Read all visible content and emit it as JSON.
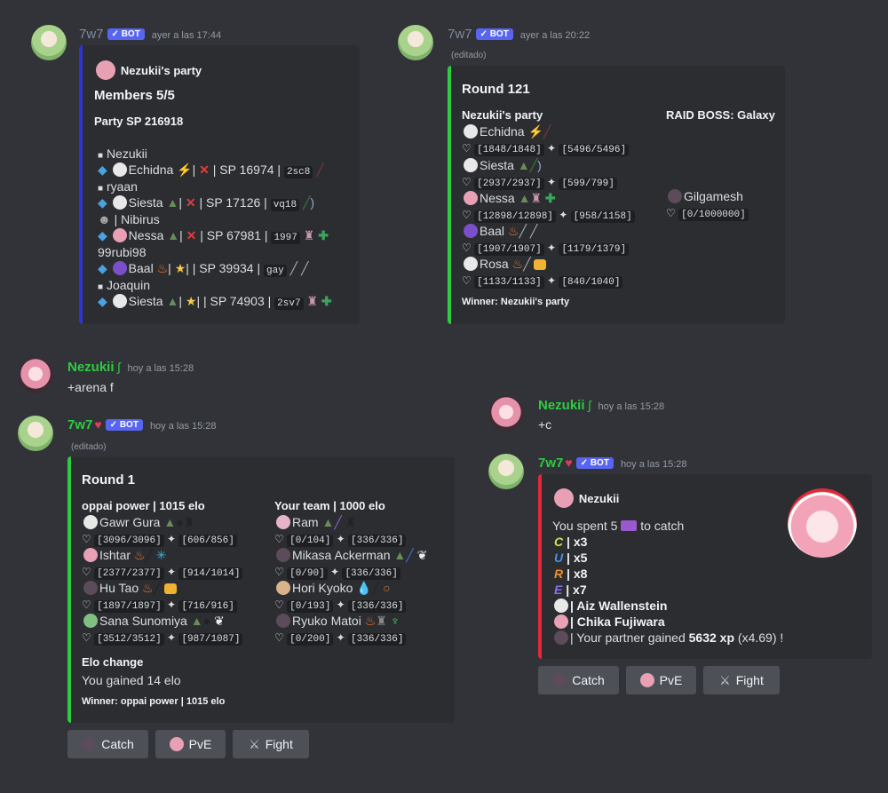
{
  "m1": {
    "user": "7w7",
    "bot": "✓ BOT",
    "time": "ayer a las 17:44",
    "author": "Nezukii's party",
    "members": "Members 5/5",
    "sp": "Party SP 216918",
    "rows": [
      {
        "name": "Nezukii"
      },
      {
        "pet": "Echidna",
        "sp": "| SP 16974 |",
        "code": "2sc8"
      },
      {
        "name": "ryaan"
      },
      {
        "pet": "Siesta",
        "sp": "| SP 17126 |",
        "code": "vq18"
      },
      {
        "name": "| Nibirus"
      },
      {
        "pet": "Nessa",
        "sp": "| SP 67981 |",
        "code": "1997"
      },
      {
        "name": "99rubi98"
      },
      {
        "pet": "Baal",
        "sp": "| SP 39934 |",
        "code": "gay"
      },
      {
        "name": "Joaquin"
      },
      {
        "pet": "Siesta",
        "sp": "| SP 74903 |",
        "code": "2sv7"
      }
    ]
  },
  "m2": {
    "user": "7w7",
    "bot": "✓ BOT",
    "time": "ayer a las 20:22",
    "edited": "(editado)",
    "round": "Round 121",
    "party_title": "Nezukii's party",
    "boss_title": "RAID BOSS: Galaxy",
    "party": [
      {
        "name": "Echidna",
        "hp": "[1848/1848]",
        "sp": "[5496/5496]"
      },
      {
        "name": "Siesta",
        "hp": "[2937/2937]",
        "sp": "[599/799]"
      },
      {
        "name": "Nessa",
        "hp": "[12898/12898]",
        "sp": "[958/1158]"
      },
      {
        "name": "Baal",
        "hp": "[1907/1907]",
        "sp": "[1179/1379]"
      },
      {
        "name": "Rosa",
        "hp": "[1133/1133]",
        "sp": "[840/1040]"
      }
    ],
    "boss": {
      "name": "Gilgamesh",
      "hp": "[0/1000000]"
    },
    "winner": "Winner: Nezukii's party"
  },
  "m3": {
    "user": "Nezukii",
    "badge": "ʃ",
    "time": "hoy a las 15:28",
    "text": "+arena f"
  },
  "m4": {
    "user": "7w7",
    "bot": "✓ BOT",
    "time": "hoy a las 15:28",
    "edited": "(editado)",
    "round": "Round 1",
    "left_title": "oppai power | 1015 elo",
    "right_title": "Your team | 1000 elo",
    "left": [
      {
        "name": "Gawr Gura",
        "hp": "[3096/3096]",
        "sp": "[606/856]"
      },
      {
        "name": "Ishtar",
        "hp": "[2377/2377]",
        "sp": "[914/1014]"
      },
      {
        "name": "Hu Tao",
        "hp": "[1897/1897]",
        "sp": "[716/916]"
      },
      {
        "name": "Sana Sunomiya",
        "hp": "[3512/3512]",
        "sp": "[987/1087]"
      }
    ],
    "right": [
      {
        "name": "Ram",
        "hp": "[0/104]",
        "sp": "[336/336]"
      },
      {
        "name": "Mikasa Ackerman",
        "hp": "[0/90]",
        "sp": "[336/336]"
      },
      {
        "name": "Hori Kyoko",
        "hp": "[0/193]",
        "sp": "[336/336]"
      },
      {
        "name": "Ryuko Matoi",
        "hp": "[0/200]",
        "sp": "[336/336]"
      }
    ],
    "elo_title": "Elo change",
    "elo_text": "You gained 14 elo",
    "winner": "Winner: oppai power | 1015 elo",
    "buttons": [
      "Catch",
      "PvE",
      "Fight"
    ]
  },
  "m5": {
    "user": "Nezukii",
    "badge": "ʃ",
    "time": "hoy a las 15:28",
    "text": "+c"
  },
  "m6": {
    "user": "7w7",
    "bot": "✓ BOT",
    "time": "hoy a las 15:28",
    "author": "Nezukii",
    "spent_pre": "You spent 5",
    "spent_post": "to catch",
    "letters": [
      {
        "l": "C",
        "x": "| x3",
        "color": "#d4e04a"
      },
      {
        "l": "U",
        "x": "| x5",
        "color": "#4a90e2"
      },
      {
        "l": "R",
        "x": "| x8",
        "color": "#f08c2b"
      },
      {
        "l": "E",
        "x": "| x7",
        "color": "#8a6cf0"
      }
    ],
    "caught1": "| Aiz Wallenstein",
    "caught2": "| Chika Fujiwara",
    "xp_pre": "| Your partner gained",
    "xp_val": "5632 xp",
    "xp_post": "(x4.69) !",
    "buttons": [
      "Catch",
      "PvE",
      "Fight"
    ]
  },
  "colors": {
    "bar_blue": "#2f33d6",
    "bar_green": "#2ecc40",
    "bar_red": "#e0293b"
  }
}
